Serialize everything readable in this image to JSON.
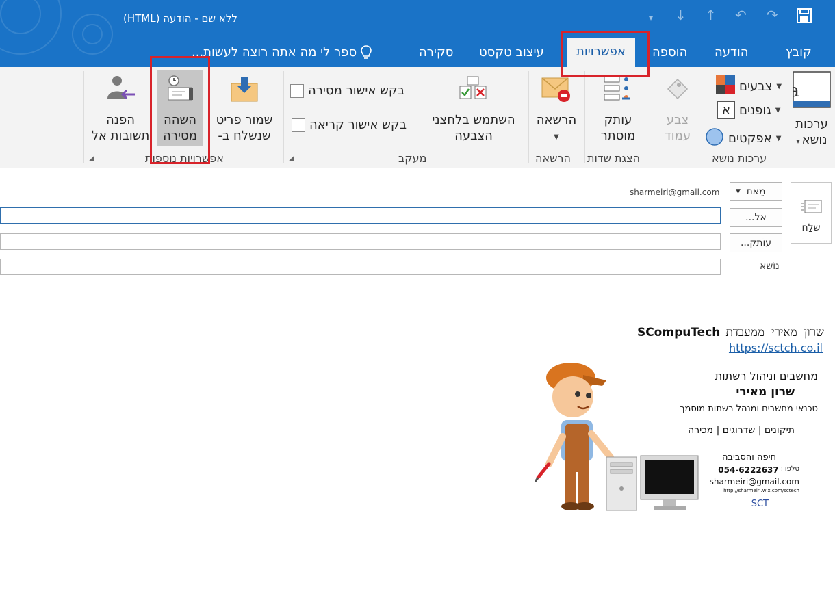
{
  "window": {
    "title": "ללא שם - הודעה (HTML)"
  },
  "tabs": {
    "file": "קובץ",
    "message": "הודעה",
    "insert": "הוספה",
    "options": "אפשרויות",
    "format_text": "עיצוב טקסט",
    "review": "סקירה",
    "tell_me": "ספר לי מה אתה רוצה לעשות..."
  },
  "ribbon": {
    "themes": {
      "themes_label": "ערכות נושא",
      "colors": "צבעים",
      "fonts": "גופנים",
      "fonts_glyph": "א",
      "effects": "אפקטים",
      "page_color": "צבע עמוד",
      "group_label": "ערכות נושא"
    },
    "show_fields": {
      "bcc": "עותק מוסתר",
      "group_label": "הצגת שדות"
    },
    "permission": {
      "permission": "הרשאה",
      "group_label": "הרשאה"
    },
    "tracking": {
      "voting": "השתמש בלחצני הצבעה",
      "delivery_receipt": "בקש אישור מסירה",
      "read_receipt": "בקש אישור קריאה",
      "group_label": "מעקב"
    },
    "more_options": {
      "save_sent": "שמור פריט שנשלח ב-",
      "delay_delivery": "השהה מסירה",
      "direct_replies": "הפנה תשובות אל",
      "group_label": "אפשרויות נוספות"
    }
  },
  "header": {
    "send_label": "שלַח",
    "from_label": "מֵאת",
    "from_email": "sharmeiri@gmail.com",
    "to_label": "אל...",
    "cc_label": "עוֹתק...",
    "subject_label": "נוֹשא",
    "to_value": "",
    "cc_value": "",
    "subject_value": ""
  },
  "signature": {
    "line1_name": "שרון מאירי ממעבדת",
    "line1_brand": "SCompuTech",
    "link": "https://sctch.co.il",
    "card": {
      "title": "מחשבים וניהול רשתות",
      "name": "שרון מאירי",
      "role": "טכנאי מחשבים ומנהל רשתות מוסמך",
      "services": "תיקונים | שדרוגים | מכירה",
      "area": "חיפה והסביבה",
      "phone_label": "טלפון:",
      "phone": "054-6222637",
      "email": "sharmeiri@gmail.com",
      "site": "http://sharmeiri.wix.com/sctech",
      "logo": "SCT"
    }
  },
  "colors": {
    "titlebar": "#1a73c7",
    "ribbon": "#f3f3f3",
    "highlight_box": "#d8232a",
    "link": "#1a5ea8"
  }
}
